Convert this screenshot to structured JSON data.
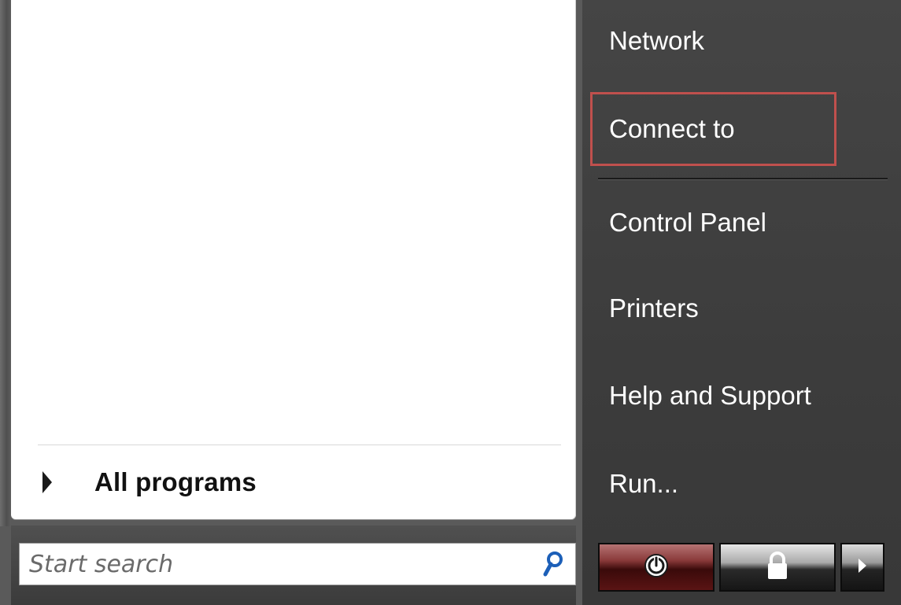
{
  "programs": {
    "all_programs_label": "All programs"
  },
  "search": {
    "placeholder": "Start search"
  },
  "right_menu": {
    "items": [
      {
        "label": "Network"
      },
      {
        "label": "Connect to"
      },
      {
        "label": "Control Panel"
      },
      {
        "label": "Printers"
      },
      {
        "label": "Help and Support"
      },
      {
        "label": "Run..."
      }
    ]
  },
  "highlight_color": "#c0504d",
  "icons": {
    "search": "search-icon",
    "power": "power-icon",
    "lock": "lock-icon",
    "more": "chevron-right-icon",
    "expand": "chevron-right-icon"
  }
}
